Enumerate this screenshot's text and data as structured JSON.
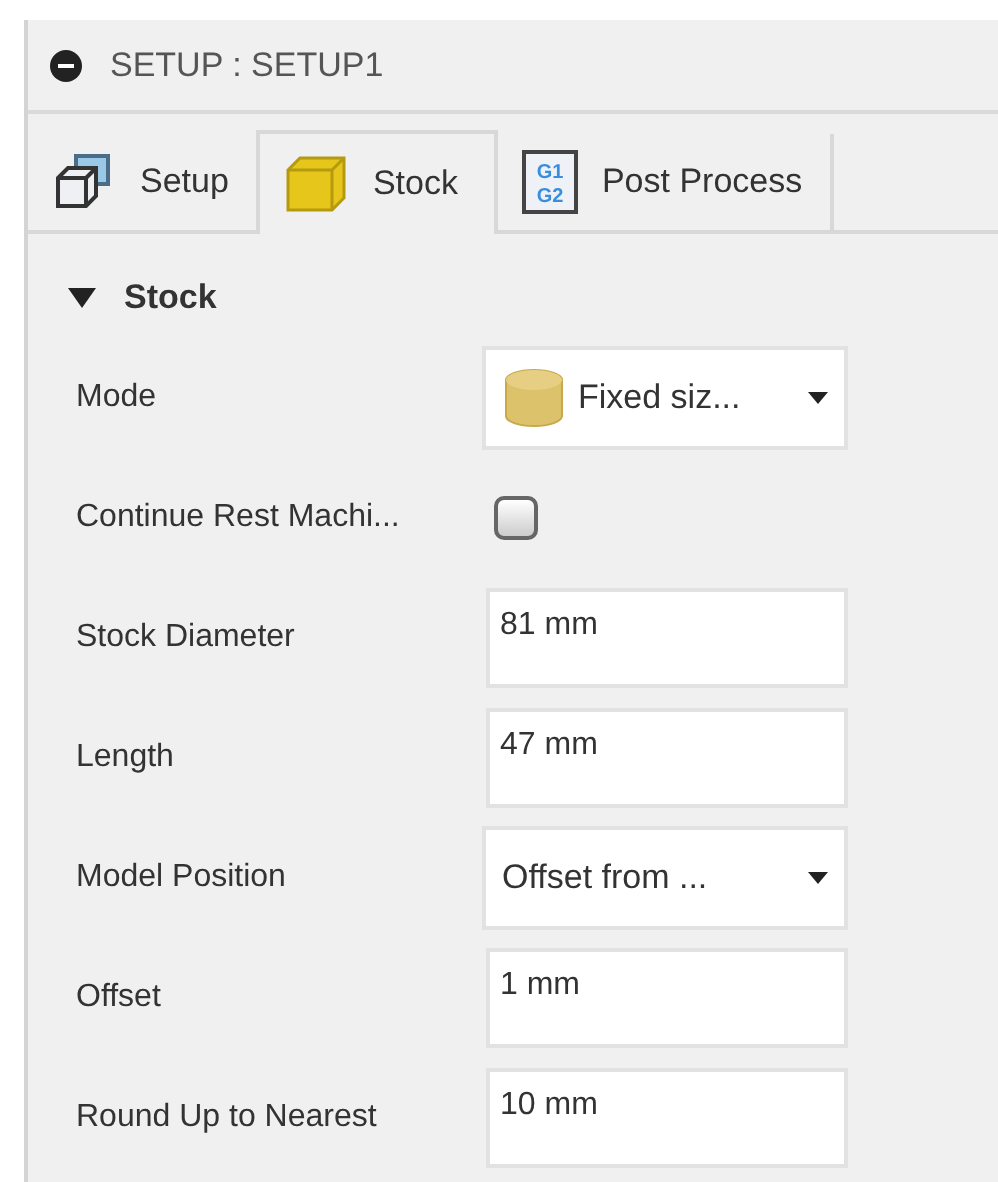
{
  "panel": {
    "title": "SETUP : SETUP1"
  },
  "tabs": [
    {
      "label": "Setup",
      "kind": "setup",
      "selected": false
    },
    {
      "label": "Stock",
      "kind": "stock",
      "selected": true
    },
    {
      "label": "Post Process",
      "kind": "post",
      "icon_text": [
        "G1",
        "G2"
      ],
      "selected": false
    }
  ],
  "section": {
    "title": "Stock",
    "expanded": true
  },
  "fields": [
    {
      "label": "Mode",
      "kind": "icon_dropdown",
      "value": "Fixed siz..."
    },
    {
      "label": "Continue Rest Machi...",
      "kind": "checkbox",
      "checked": false
    },
    {
      "label": "Stock Diameter",
      "kind": "text",
      "value": "81 mm"
    },
    {
      "label": "Length",
      "kind": "text",
      "value": "47 mm"
    },
    {
      "label": "Model Position",
      "kind": "dropdown",
      "value": "Offset from ..."
    },
    {
      "label": "Offset",
      "kind": "text",
      "value": "1 mm"
    },
    {
      "label": "Round Up to Nearest",
      "kind": "text",
      "value": "10 mm"
    }
  ]
}
